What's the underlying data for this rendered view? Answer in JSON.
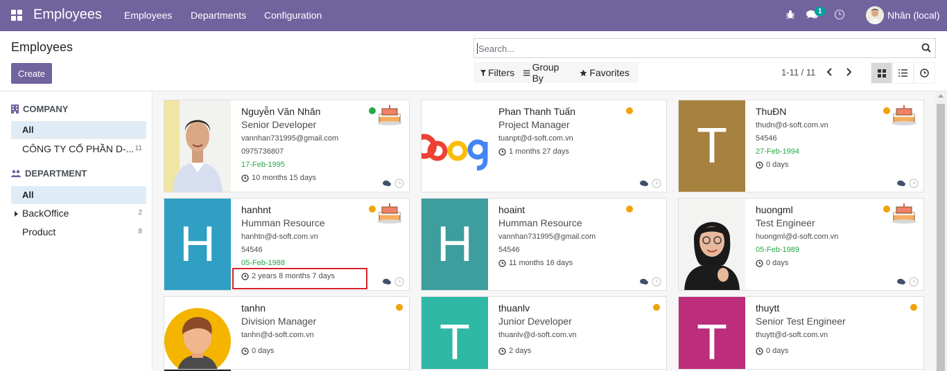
{
  "topbar": {
    "app_title": "Employees",
    "menu": [
      "Employees",
      "Departments",
      "Configuration"
    ],
    "chat_count": "1",
    "user_name": "Nhân (local)"
  },
  "control": {
    "breadcrumb": "Employees",
    "create_label": "Create",
    "search_placeholder": "Search...",
    "filters_label": "Filters",
    "groupby_label": "Group By",
    "favorites_label": "Favorites",
    "pager": "1-11 / 11"
  },
  "sidebar": {
    "company_heading": "COMPANY",
    "company_all": "All",
    "companies": [
      {
        "label": "CÔNG TY CỔ PHẦN D-...",
        "count": "11"
      }
    ],
    "department_heading": "DEPARTMENT",
    "department_all": "All",
    "departments": [
      {
        "label": "BackOffice",
        "count": "2"
      },
      {
        "label": "Product",
        "count": "8"
      }
    ]
  },
  "colors": {
    "brand": "#71639e",
    "status_online": "#28a745",
    "status_away": "#f0a30a",
    "birthday": "#28a745"
  },
  "employees": [
    {
      "name": "Nguyễn Văn Nhân",
      "job": "Senior Developer",
      "email": "vannhan731995@gmail.com",
      "phone": "0975736807",
      "birthday": "17-Feb-1995",
      "tenure": "10 months 15 days",
      "status": "online",
      "avatar": "photo-man",
      "has_cake": true
    },
    {
      "name": "Phan Thanh Tuấn",
      "job": "Project Manager",
      "email": "tuanpt@d-soft.com.vn",
      "tenure": "1 months 27 days",
      "status": "away",
      "avatar": "google-logo",
      "logo_text": "oog",
      "has_cake": false
    },
    {
      "name": "ThuĐN",
      "job": "",
      "email": "thudn@d-soft.com.vn",
      "phone": "54546",
      "birthday": "27-Feb-1994",
      "tenure": "0 days",
      "status": "away",
      "avatar": "letter",
      "letter": "T",
      "avatar_color": "#a7823e",
      "has_cake": true
    },
    {
      "name": "hanhnt",
      "job": "Humman Resource",
      "email": "hanhtn@d-soft.com.vn",
      "phone": "54546",
      "birthday": "05-Feb-1988",
      "tenure": "2 years 8 months 7 days",
      "status": "away",
      "avatar": "letter",
      "letter": "H",
      "avatar_color": "#2f9fc3",
      "has_cake": true
    },
    {
      "name": "hoaint",
      "job": "Humman Resource",
      "email": "vannhan731995@gmail.com",
      "phone": "54546",
      "tenure": "11 months 16 days",
      "status": "away",
      "avatar": "letter",
      "letter": "H",
      "avatar_color": "#3e9d9d",
      "has_cake": false
    },
    {
      "name": "huongml",
      "job": "Test Engineer",
      "email": "huongml@d-soft.com.vn",
      "birthday": "05-Feb-1989",
      "tenure": "0 days",
      "status": "away",
      "avatar": "photo-woman",
      "has_cake": true
    },
    {
      "name": "tanhn",
      "job": "Division Manager",
      "email": "tanhn@d-soft.com.vn",
      "tenure": "0 days",
      "status": "away",
      "avatar": "cartoon-man",
      "has_cake": false
    },
    {
      "name": "thuanlv",
      "job": "Junior Developer",
      "email": "thuanlv@d-soft.com.vn",
      "tenure": "2 days",
      "status": "away",
      "avatar": "letter",
      "letter": "T",
      "avatar_color": "#2fb8a5",
      "has_cake": false
    },
    {
      "name": "thuytt",
      "job": "Senior Test Engineer",
      "email": "thuytt@d-soft.com.vn",
      "tenure": "0 days",
      "status": "away",
      "avatar": "letter",
      "letter": "T",
      "avatar_color": "#bc2d7b",
      "has_cake": false
    }
  ]
}
